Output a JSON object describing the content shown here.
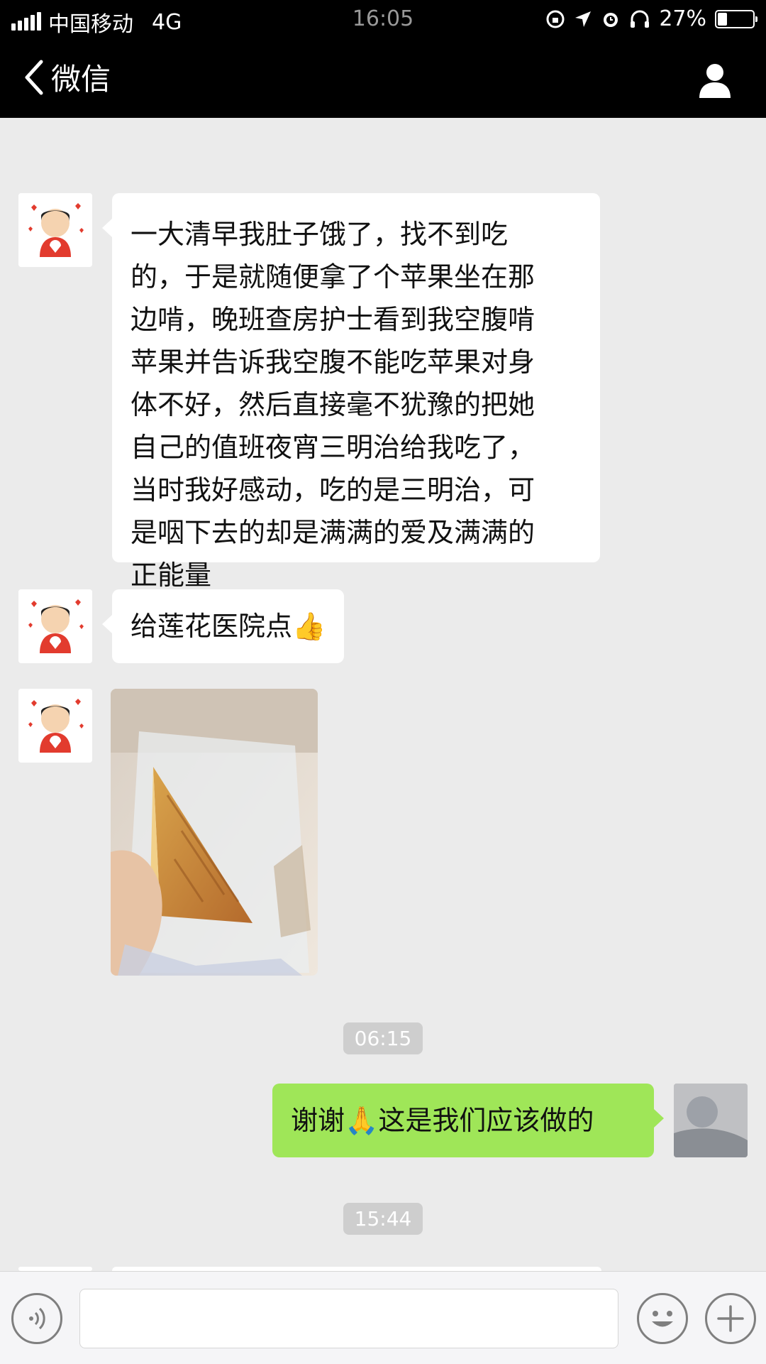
{
  "status_bar": {
    "carrier": "中国移动",
    "network": "4G",
    "time": "16:05",
    "battery_percent": "27%",
    "battery_level": 0.27
  },
  "nav": {
    "back_label": "微信"
  },
  "messages": [
    {
      "direction": "incoming",
      "type": "text",
      "lines": [
        "一大清早我肚子饿了，找不到吃",
        "的，于是就随便拿了个苹果坐在那",
        "边啃，晚班查房护士看到我空腹啃",
        "苹果并告诉我空腹不能吃苹果对身",
        "体不好，然后直接毫不犹豫的把她",
        "自己的值班夜宵三明治给我吃了，",
        "当时我好感动，吃的是三明治，可",
        "是咽下去的却是满满的爱及满满的",
        "正能量"
      ]
    },
    {
      "direction": "incoming",
      "type": "text",
      "text": "给莲花医院点👍"
    },
    {
      "direction": "incoming",
      "type": "image",
      "image_desc": "sandwich-photo"
    },
    {
      "type": "timestamp",
      "text": "06:15"
    },
    {
      "direction": "outgoing",
      "type": "text",
      "text": "谢谢🙏这是我们应该做的"
    },
    {
      "type": "timestamp",
      "text": "15:44"
    }
  ],
  "input_bar": {
    "voice_icon": "voice-icon",
    "emoji_icon": "emoji-icon",
    "plus_icon": "plus-icon",
    "message_value": ""
  },
  "colors": {
    "outgoing_bubble": "#9fe658",
    "incoming_bubble": "#ffffff",
    "chat_background": "#ebebeb",
    "header_background": "#000000"
  }
}
